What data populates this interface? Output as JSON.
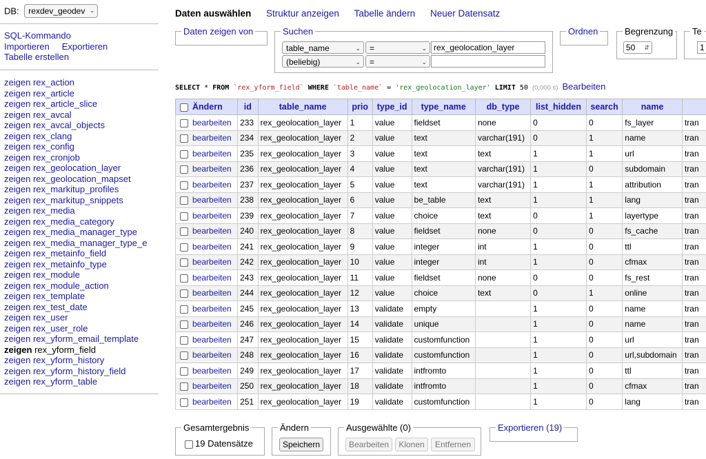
{
  "sidebar": {
    "db_label": "DB:",
    "db_value": "rexdev_geodev",
    "commands": [
      "SQL-Kommando",
      "Importieren",
      "Exportieren",
      "Tabelle erstellen"
    ],
    "show_word": "zeigen",
    "tables": [
      "rex_action",
      "rex_article",
      "rex_article_slice",
      "rex_avcal",
      "rex_avcal_objects",
      "rex_clang",
      "rex_config",
      "rex_cronjob",
      "rex_geolocation_layer",
      "rex_geolocation_mapset",
      "rex_markitup_profiles",
      "rex_markitup_snippets",
      "rex_media",
      "rex_media_category",
      "rex_media_manager_type",
      "rex_media_manager_type_e",
      "rex_metainfo_field",
      "rex_metainfo_type",
      "rex_module",
      "rex_module_action",
      "rex_template",
      "rex_test_date",
      "rex_user",
      "rex_user_role",
      "rex_yform_email_template",
      "rex_yform_field",
      "rex_yform_history",
      "rex_yform_history_field",
      "rex_yform_table"
    ],
    "current_table": "rex_yform_field"
  },
  "tabs": [
    "Daten auswählen",
    "Struktur anzeigen",
    "Tabelle ändern",
    "Neuer Datensatz"
  ],
  "filters": {
    "show_columns_legend": "Daten zeigen von",
    "search_legend": "Suchen",
    "search_rows": [
      {
        "column": "table_name",
        "operator": "=",
        "value": "rex_geolocation_layer"
      },
      {
        "column": "(beliebig)",
        "operator": "=",
        "value": ""
      }
    ],
    "order_legend": "Ordnen",
    "limit_legend": "Begrenzung",
    "limit_value": "50",
    "text_length_legend": "Te",
    "text_length_value": "1"
  },
  "sql": {
    "select": "SELECT",
    "star": "*",
    "from": "FROM",
    "table": "`rex_yform_field`",
    "where": "WHERE",
    "column": "`table_name`",
    "eq": "=",
    "value": "'rex_geolocation_layer'",
    "limit": "LIMIT",
    "limit_num": "50",
    "duration": "(0,000 s)",
    "edit_link": "Bearbeiten"
  },
  "table": {
    "headers": [
      "Ändern",
      "id",
      "table_name",
      "prio",
      "type_id",
      "type_name",
      "db_type",
      "list_hidden",
      "search",
      "name"
    ],
    "edit_label": "bearbeiten",
    "next_col_partial": "tran",
    "rows": [
      [
        "233",
        "rex_geolocation_layer",
        "1",
        "value",
        "fieldset",
        "none",
        "0",
        "0",
        "fs_layer"
      ],
      [
        "234",
        "rex_geolocation_layer",
        "2",
        "value",
        "text",
        "varchar(191)",
        "0",
        "1",
        "name"
      ],
      [
        "235",
        "rex_geolocation_layer",
        "3",
        "value",
        "text",
        "text",
        "1",
        "1",
        "url"
      ],
      [
        "236",
        "rex_geolocation_layer",
        "4",
        "value",
        "text",
        "varchar(191)",
        "1",
        "0",
        "subdomain"
      ],
      [
        "237",
        "rex_geolocation_layer",
        "5",
        "value",
        "text",
        "varchar(191)",
        "1",
        "1",
        "attribution"
      ],
      [
        "238",
        "rex_geolocation_layer",
        "6",
        "value",
        "be_table",
        "text",
        "1",
        "1",
        "lang"
      ],
      [
        "239",
        "rex_geolocation_layer",
        "7",
        "value",
        "choice",
        "text",
        "0",
        "1",
        "layertype"
      ],
      [
        "240",
        "rex_geolocation_layer",
        "8",
        "value",
        "fieldset",
        "none",
        "0",
        "0",
        "fs_cache"
      ],
      [
        "241",
        "rex_geolocation_layer",
        "9",
        "value",
        "integer",
        "int",
        "1",
        "0",
        "ttl"
      ],
      [
        "242",
        "rex_geolocation_layer",
        "10",
        "value",
        "integer",
        "int",
        "1",
        "0",
        "cfmax"
      ],
      [
        "243",
        "rex_geolocation_layer",
        "11",
        "value",
        "fieldset",
        "none",
        "0",
        "0",
        "fs_rest"
      ],
      [
        "244",
        "rex_geolocation_layer",
        "12",
        "value",
        "choice",
        "text",
        "0",
        "1",
        "online"
      ],
      [
        "245",
        "rex_geolocation_layer",
        "13",
        "validate",
        "empty",
        "",
        "1",
        "0",
        "name"
      ],
      [
        "246",
        "rex_geolocation_layer",
        "14",
        "validate",
        "unique",
        "",
        "1",
        "0",
        "name"
      ],
      [
        "247",
        "rex_geolocation_layer",
        "15",
        "validate",
        "customfunction",
        "",
        "1",
        "0",
        "url"
      ],
      [
        "248",
        "rex_geolocation_layer",
        "16",
        "validate",
        "customfunction",
        "",
        "1",
        "0",
        "url,subdomain"
      ],
      [
        "249",
        "rex_geolocation_layer",
        "17",
        "validate",
        "intfromto",
        "",
        "1",
        "0",
        "ttl"
      ],
      [
        "250",
        "rex_geolocation_layer",
        "18",
        "validate",
        "intfromto",
        "",
        "1",
        "0",
        "cfmax"
      ],
      [
        "251",
        "rex_geolocation_layer",
        "19",
        "validate",
        "customfunction",
        "",
        "1",
        "0",
        "lang"
      ]
    ]
  },
  "footer": {
    "total_legend": "Gesamtergebnis",
    "total_checkbox_label": "19 Datensätze",
    "modify_legend": "Ändern",
    "save_button": "Speichern",
    "selected_legend": "Ausgewählte (0)",
    "edit_button": "Bearbeiten",
    "clone_button": "Klonen",
    "delete_button": "Entfernen",
    "export_legend": "Exportieren (19)"
  },
  "colors": {
    "link": "#1a1aa6",
    "header_bg": "#dde0fb",
    "row_alt": "#f2f2f2"
  }
}
